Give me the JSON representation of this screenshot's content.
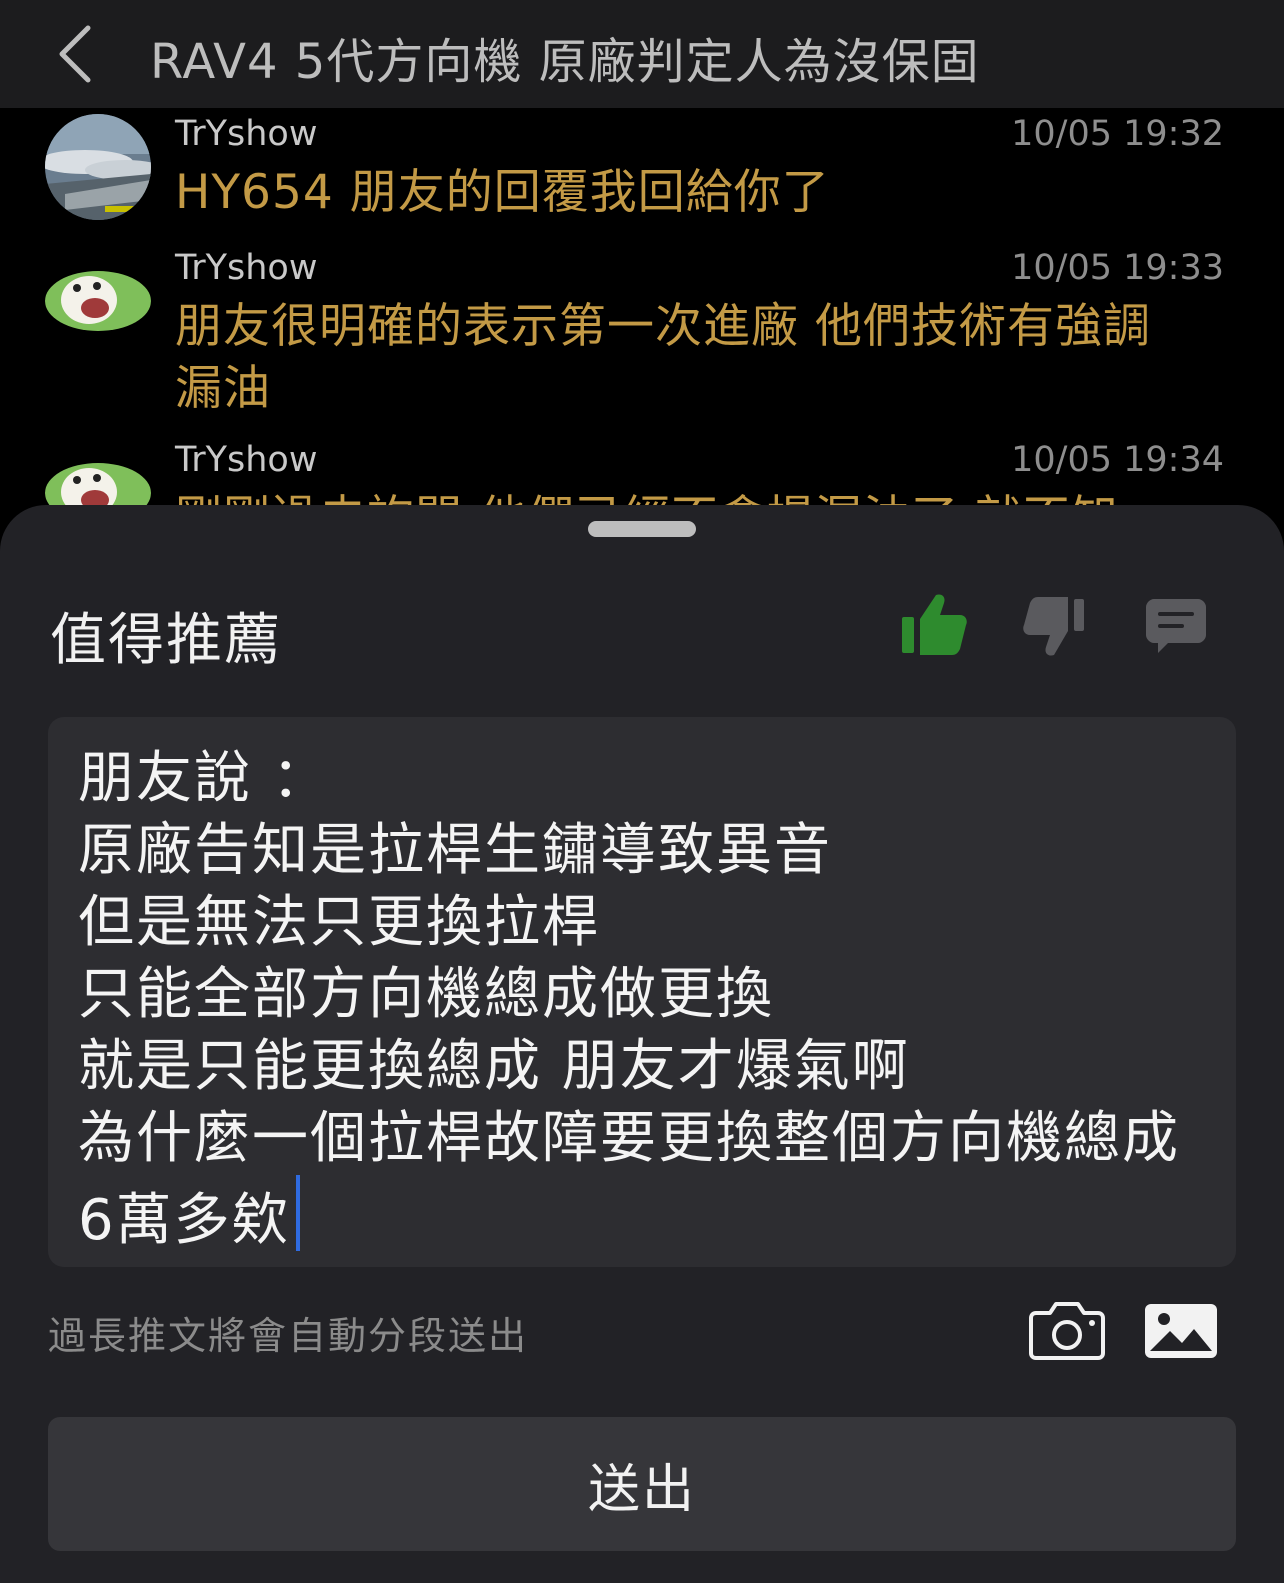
{
  "header": {
    "title": "RAV4 5代方向機 原廠判定人為沒保固"
  },
  "messages": [
    {
      "author": "TrYshow",
      "time": "10/05 19:32",
      "text": "HY654 朋友的回覆我回給你了"
    },
    {
      "author": "TrYshow",
      "time": "10/05 19:33",
      "text": "朋友很明確的表示第一次進廠 他們技術有強調漏油"
    },
    {
      "author": "TrYshow",
      "time": "10/05 19:34",
      "text": "剛剛過去詢問 他們已經不會提漏油了 就不知"
    }
  ],
  "compose": {
    "title": "值得推薦",
    "actions": {
      "like_icon": "thumbs-up-icon",
      "dislike_icon": "thumbs-down-icon",
      "comment_icon": "comment-icon"
    },
    "active_color": "#2e8b2e",
    "text_lines": [
      "朋友說 ：",
      "原廠告知是拉桿生鏽導致異音",
      "但是無法只更換拉桿",
      "只能全部方向機總成做更換",
      "就是只能更換總成 朋友才爆氣啊",
      "為什麼一個拉桿故障要更換整個方向機總成",
      "6萬多欸"
    ],
    "hint": "過長推文將會自動分段送出",
    "send_label": "送出"
  }
}
